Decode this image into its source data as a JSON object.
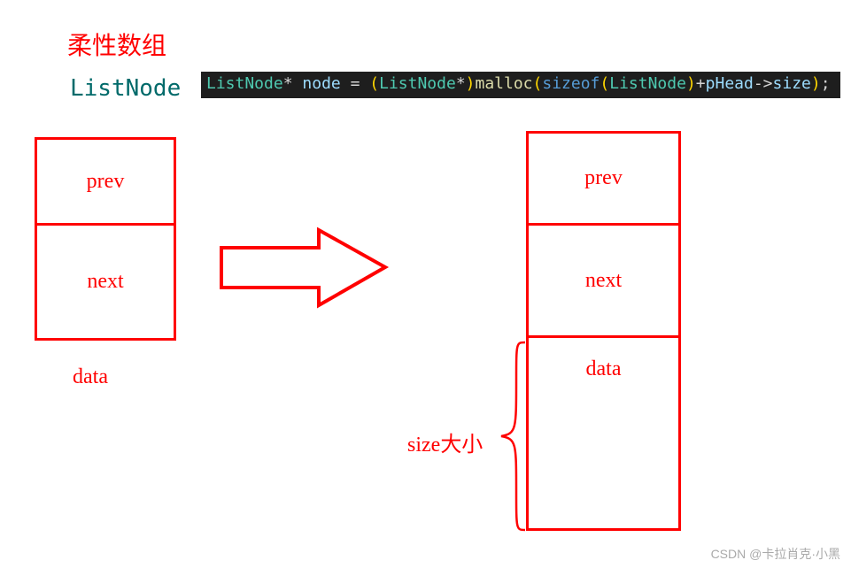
{
  "title": "柔性数组",
  "listnode_label": "ListNode",
  "code": {
    "type1": "ListNode",
    "star1": "*",
    "var1": "node",
    "eq": " = ",
    "lparen1": "(",
    "type2": "ListNode",
    "star2": "*",
    "rparen1": ")",
    "func": "malloc",
    "lparen2": "(",
    "kw": "sizeof",
    "lparen3": "(",
    "type3": "ListNode",
    "rparen3": ")",
    "plus": "+",
    "var2": "pHead",
    "arrow": "->",
    "var3": "size",
    "rparen2": ")",
    "semi": ";"
  },
  "code_subtext": "",
  "left": {
    "prev": "prev",
    "next": "next",
    "data": "data"
  },
  "right": {
    "prev": "prev",
    "next": "next",
    "data": "data"
  },
  "size_label": "size大小",
  "watermark": "CSDN @卡拉肖克·小黑"
}
